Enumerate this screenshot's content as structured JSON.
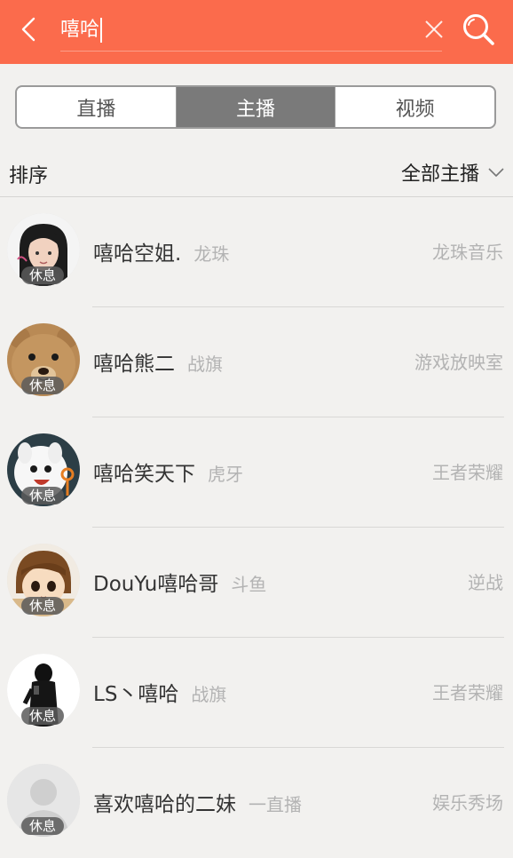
{
  "colors": {
    "header": "#fb6b4c",
    "segment_active": "#7a7a7a",
    "background": "#f2f1ef"
  },
  "header": {
    "back_icon": "chevron-left-icon",
    "search_value": "嘻哈",
    "clear_icon": "close-icon",
    "search_icon": "search-icon"
  },
  "tabs": [
    {
      "label": "直播",
      "active": false
    },
    {
      "label": "主播",
      "active": true
    },
    {
      "label": "视频",
      "active": false
    }
  ],
  "sort": {
    "label": "排序",
    "filter_label": "全部主播",
    "filter_icon": "chevron-down-icon"
  },
  "results": [
    {
      "name": "嘻哈空姐.",
      "platform": "龙珠",
      "category": "龙珠音乐",
      "status": "休息"
    },
    {
      "name": "嘻哈熊二",
      "platform": "战旗",
      "category": "游戏放映室",
      "status": "休息"
    },
    {
      "name": "嘻哈笑天下",
      "platform": "虎牙",
      "category": "王者荣耀",
      "status": "休息"
    },
    {
      "name": "DouYu嘻哈哥",
      "platform": "斗鱼",
      "category": "逆战",
      "status": "休息"
    },
    {
      "name": "LS丶嘻哈",
      "platform": "战旗",
      "category": "王者荣耀",
      "status": "休息"
    },
    {
      "name": "喜欢嘻哈的二妹",
      "platform": "一直播",
      "category": "娱乐秀场",
      "status": "休息"
    }
  ]
}
